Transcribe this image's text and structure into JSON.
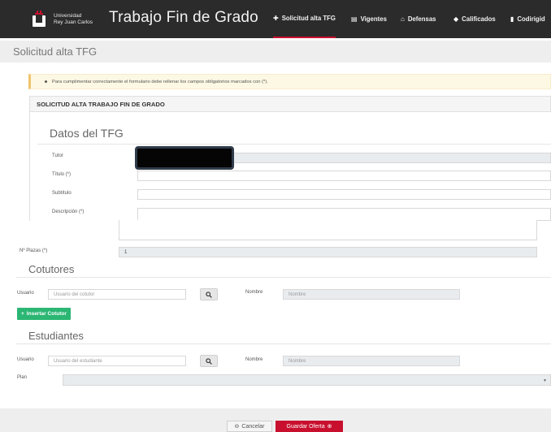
{
  "brand": {
    "university_line1": "Universidad",
    "university_line2": "Rey Juan Carlos",
    "app_title": "Trabajo Fin de Grado",
    "accent_color": "#c8102e"
  },
  "nav": {
    "items": [
      {
        "label": "Solicitud alta TFG",
        "icon": "plus-icon",
        "active": true
      },
      {
        "label": "Vigentes",
        "icon": "document-icon"
      },
      {
        "label": "Defensas",
        "icon": "institution-icon"
      },
      {
        "label": "Calificados",
        "icon": "graduation-cap-icon"
      },
      {
        "label": "Codirigid",
        "icon": "file-icon"
      }
    ]
  },
  "page": {
    "title": "Solicitud alta TFG",
    "alert": "Para cumplimentar correctamente el formulario debe rellenar los campos obligatorios marcados con (*).",
    "panel_title": "SOLICITUD ALTA TRABAJO FIN DE GRADO"
  },
  "datos": {
    "section_title": "Datos del TFG",
    "tutor_label": "Tutor",
    "titulo_label": "Título (*)",
    "subtitulo_label": "Subtítulo",
    "descripcion_label": "Descripción (*)",
    "plazas_label": "Nº Plazas (*)",
    "plazas_value": "1"
  },
  "cotutores": {
    "section_title": "Cotutores",
    "usuario_label": "Usuario",
    "usuario_placeholder": "Usuario del cotutor",
    "nombre_label": "Nombre",
    "nombre_placeholder": "Nombre",
    "add_button": "Insertar Cotutor"
  },
  "estudiantes": {
    "section_title": "Estudiantes",
    "usuario_label": "Usuario",
    "usuario_placeholder": "Usuario del estudiante",
    "nombre_label": "Nombre",
    "nombre_placeholder": "Nombre",
    "plan_label": "Plan"
  },
  "footer": {
    "cancel_label": "Cancelar",
    "save_label": "Guardar Oferta"
  }
}
